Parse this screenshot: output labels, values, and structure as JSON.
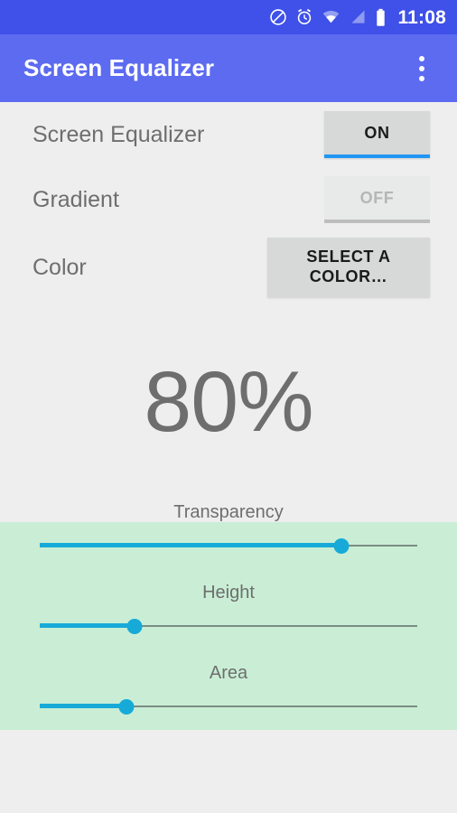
{
  "status_bar": {
    "time": "11:08",
    "icons": [
      "do-not-disturb-icon",
      "alarm-icon",
      "wifi-icon",
      "signal-icon",
      "battery-icon"
    ],
    "background_color": "#3f51e8"
  },
  "app_bar": {
    "title": "Screen Equalizer",
    "overflow_menu_icon": "overflow-menu-icon",
    "background_color": "#5c6bf0",
    "title_color": "#ffffff"
  },
  "settings": {
    "rows": [
      {
        "label": "Screen Equalizer",
        "button": "ON",
        "state": "on"
      },
      {
        "label": "Gradient",
        "button": "OFF",
        "state": "off"
      },
      {
        "label": "Color",
        "button": "SELECT A COLOR…",
        "state": "action"
      }
    ],
    "accent_on_color": "#2196f3",
    "label_color": "#6e6e6e"
  },
  "percent_display": {
    "value": "80%",
    "color": "#6e6e6e"
  },
  "overlay_band": {
    "color": "#c9eed5"
  },
  "sliders": {
    "accent_color": "#17aad8",
    "track_color": "#7b8c84",
    "items": [
      {
        "label": "Transparency",
        "value": 80
      },
      {
        "label": "Height",
        "value": 25
      },
      {
        "label": "Area",
        "value": 23
      }
    ]
  }
}
